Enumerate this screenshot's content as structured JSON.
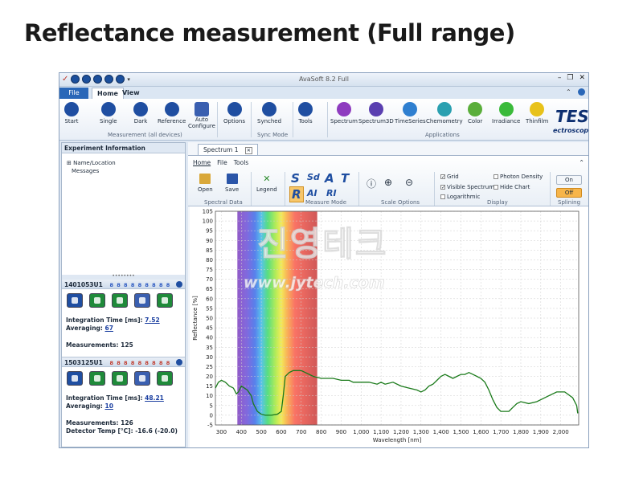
{
  "slide": {
    "title": "Reflectance measurement (Full range)"
  },
  "app": {
    "title": "AvaSoft 8.2 Full",
    "tabs": {
      "file": "File",
      "home": "Home",
      "view": "View"
    },
    "ribbon": {
      "start": "Start",
      "single": "Single",
      "dark": "Dark",
      "reference": "Reference",
      "auto_configure_1": "Auto",
      "auto_configure_2": "Configure",
      "group_measurement": "Measurement (all devices)",
      "options": "Options",
      "synched": "Synched",
      "group_sync": "Sync Mode",
      "tools": "Tools",
      "spectrum": "Spectrum",
      "spectrum3d": "Spectrum3D",
      "timeseries": "TimeSeries",
      "chemometry": "Chemometry",
      "color": "Color",
      "irradiance": "Irradiance",
      "thinfilm": "Thinfilm",
      "group_applications": "Applications",
      "brand": "TES",
      "brand_sub": "ectroscopy"
    }
  },
  "left": {
    "header": "Experiment Information",
    "tree": [
      "⊞ Name/Location",
      "Messages"
    ],
    "spec1": {
      "id": "1401053U1",
      "leds": "8 8 8 8 8 8 8 8 8",
      "integration_label": "Integration Time  [ms]:",
      "integration_value": "7.52",
      "averaging_label": "Averaging:",
      "averaging_value": "67",
      "measurements": "Measurements: 125"
    },
    "spec2": {
      "id": "1503125U1",
      "leds": "8 8 8 8 8 8 8 8 8",
      "integration_label": "Integration Time  [ms]:",
      "integration_value": "48.21",
      "averaging_label": "Averaging:",
      "averaging_value": "10",
      "measurements": "Measurements: 126",
      "detector_temp": "Detector Temp [°C]: -16.6 (-20.0)"
    }
  },
  "spectrum": {
    "doc_tab": "Spectrum 1",
    "tabs": [
      "Home",
      "File",
      "Tools"
    ],
    "open": "Open",
    "save": "Save",
    "group_spectral": "Spectral Data",
    "legend": "Legend",
    "group_measure": "Measure Mode",
    "letters": [
      "S",
      "Sd",
      "A",
      "T",
      "R",
      "AI",
      "RI"
    ],
    "group_scale": "Scale Options",
    "grid": "Grid",
    "visible_spectrum": "Visible Spectrum",
    "logarithmic": "Logarithmic",
    "photon_density": "Photon Density",
    "hide_chart": "Hide Chart",
    "group_display": "Display",
    "on": "On",
    "off": "Off",
    "group_splining": "Splining"
  },
  "watermark": {
    "korean": "진영테크",
    "url": "www.jytech.com"
  },
  "chart_data": {
    "type": "line",
    "xlabel": "Wavelength [nm]",
    "ylabel": "Reflectance [%]",
    "xlim": [
      270,
      2090
    ],
    "ylim": [
      -5,
      105
    ],
    "x_ticks": [
      "300",
      "400",
      "500",
      "600",
      "700",
      "800",
      "900",
      "1,000",
      "1,100",
      "1,200",
      "1,300",
      "1,400",
      "1,500",
      "1,600",
      "1,700",
      "1,800",
      "1,900",
      "2,000"
    ],
    "y_ticks": [
      -5,
      0,
      5,
      10,
      15,
      20,
      25,
      30,
      35,
      40,
      45,
      50,
      55,
      60,
      65,
      70,
      75,
      80,
      85,
      90,
      95,
      100,
      105
    ],
    "visible_band": [
      380,
      780
    ],
    "line_color": "#1a7a1a",
    "series": [
      {
        "x": [
          270,
          285,
          300,
          320,
          340,
          360,
          375,
          385,
          400,
          430,
          450,
          460,
          480,
          500,
          520,
          550,
          580,
          600,
          610,
          620,
          640,
          660,
          700,
          720,
          760,
          800,
          860,
          900,
          940,
          960,
          1000,
          1040,
          1080,
          1100,
          1120,
          1160,
          1200,
          1240,
          1280,
          1300,
          1320,
          1340,
          1360,
          1380,
          1400,
          1420,
          1440,
          1460,
          1480,
          1500,
          1520,
          1540,
          1560,
          1580,
          1600,
          1620,
          1640,
          1660,
          1680,
          1700,
          1740,
          1760,
          1780,
          1800,
          1840,
          1880,
          1900,
          1940,
          1980,
          2020,
          2060,
          2080,
          2085
        ],
        "values": [
          14,
          17,
          18,
          17,
          15,
          14,
          11,
          12,
          15,
          13,
          10,
          6,
          2,
          0.5,
          0,
          0,
          0.5,
          2,
          10,
          20,
          22,
          23,
          23,
          22,
          20,
          19,
          19,
          18,
          18,
          17,
          17,
          17,
          16,
          17,
          16,
          17,
          15,
          14,
          13,
          12,
          13,
          15,
          16,
          18,
          20,
          21,
          20,
          19,
          20,
          21,
          21,
          22,
          21,
          20,
          19,
          17,
          13,
          8,
          4,
          2,
          2,
          4,
          6,
          7,
          6,
          7,
          8,
          10,
          12,
          12,
          9,
          5,
          1
        ]
      }
    ]
  }
}
